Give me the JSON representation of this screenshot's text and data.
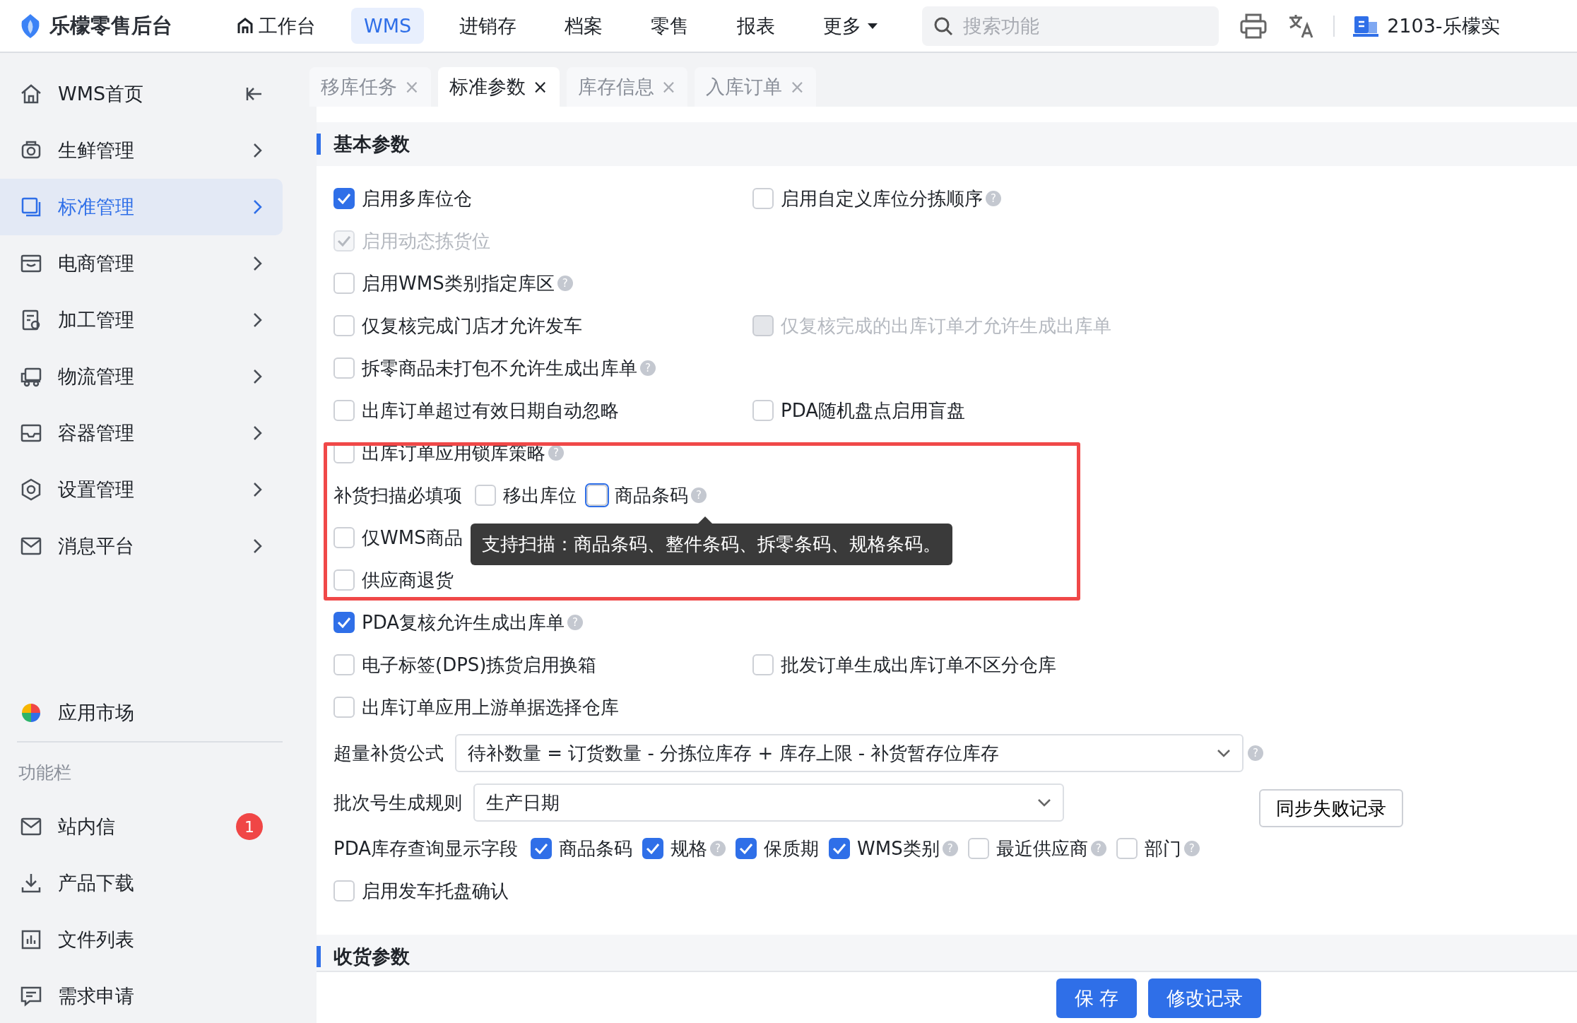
{
  "app": {
    "title": "乐檬零售后台"
  },
  "top_nav": [
    {
      "label": "工作台",
      "selected": false,
      "home": true
    },
    {
      "label": "WMS",
      "selected": true
    },
    {
      "label": "进销存",
      "selected": false
    },
    {
      "label": "档案",
      "selected": false
    },
    {
      "label": "零售",
      "selected": false
    },
    {
      "label": "报表",
      "selected": false
    },
    {
      "label": "更多",
      "selected": false,
      "dropdown": true
    }
  ],
  "search": {
    "placeholder": "搜索功能"
  },
  "store": {
    "name": "2103-乐檬实"
  },
  "sidebar": {
    "items": [
      {
        "label": "WMS首页",
        "selected": false,
        "collapse": true
      },
      {
        "label": "生鲜管理",
        "selected": false
      },
      {
        "label": "标准管理",
        "selected": true
      },
      {
        "label": "电商管理",
        "selected": false
      },
      {
        "label": "加工管理",
        "selected": false
      },
      {
        "label": "物流管理",
        "selected": false
      },
      {
        "label": "容器管理",
        "selected": false
      },
      {
        "label": "设置管理",
        "selected": false
      },
      {
        "label": "消息平台",
        "selected": false
      }
    ],
    "market": {
      "label": "应用市场"
    },
    "section_title": "功能栏",
    "tools": [
      {
        "label": "站内信",
        "badge": "1"
      },
      {
        "label": "产品下载"
      },
      {
        "label": "文件列表"
      },
      {
        "label": "需求申请"
      }
    ]
  },
  "tabs": [
    {
      "label": "移库任务",
      "selected": false,
      "close": "×"
    },
    {
      "label": "标准参数",
      "selected": true,
      "close": "×"
    },
    {
      "label": "库存信息",
      "selected": false,
      "close": "×"
    },
    {
      "label": "入库订单",
      "selected": false,
      "close": "×"
    }
  ],
  "sections": [
    {
      "title": "基本参数",
      "rows": [
        {
          "kind": "checks",
          "items": [
            {
              "label": "启用多库位仓",
              "checked": true,
              "disabled": false
            },
            {
              "label": "启用自定义库位分拣顺序",
              "checked": false,
              "disabled": false,
              "help": "?"
            }
          ]
        },
        {
          "kind": "checks",
          "items": [
            {
              "label": "启用动态拣货位",
              "checked": true,
              "disabled": true
            }
          ]
        },
        {
          "kind": "checks",
          "items": [
            {
              "label": "启用WMS类别指定库区",
              "checked": false,
              "disabled": false,
              "help": "?"
            }
          ]
        },
        {
          "kind": "checks",
          "items": [
            {
              "label": "仅复核完成门店才允许发车",
              "checked": false,
              "disabled": false
            },
            {
              "label": "仅复核完成的出库订单才允许生成出库单",
              "checked": false,
              "disabled": true
            }
          ]
        },
        {
          "kind": "checks",
          "items": [
            {
              "label": "拆零商品未打包不允许生成出库单",
              "checked": false,
              "disabled": false,
              "help": "?"
            }
          ]
        },
        {
          "kind": "checks",
          "items": [
            {
              "label": "出库订单超过有效日期自动忽略",
              "checked": false,
              "disabled": false
            },
            {
              "label": "PDA随机盘点启用盲盘",
              "checked": false,
              "disabled": false
            }
          ]
        },
        {
          "kind": "checks",
          "items": [
            {
              "label": "出库订单应用锁库策略",
              "checked": false,
              "disabled": false,
              "help": "?"
            }
          ]
        },
        {
          "kind": "group",
          "label": "补货扫描必填项",
          "highlighted": true,
          "items": [
            {
              "label": "移出库位",
              "checked": false
            },
            {
              "label": "商品条码",
              "checked": false,
              "focused": true,
              "help": "?",
              "tooltip": "支持扫描：商品条码、整件条码、拆零条码、规格条码。"
            }
          ]
        },
        {
          "kind": "checks",
          "items": [
            {
              "label": "仅WMS商品",
              "checked": false,
              "disabled": false
            }
          ]
        },
        {
          "kind": "checks",
          "items": [
            {
              "label": "供应商退货",
              "checked": false,
              "disabled": false
            }
          ]
        },
        {
          "kind": "checks",
          "items": [
            {
              "label": "PDA复核允许生成出库单",
              "checked": true,
              "disabled": false,
              "help": "?"
            }
          ]
        },
        {
          "kind": "checks",
          "items": [
            {
              "label": "电子标签(DPS)拣货启用换箱",
              "checked": false,
              "disabled": false
            },
            {
              "label": "批发订单生成出库订单不区分仓库",
              "checked": false,
              "disabled": false
            }
          ]
        },
        {
          "kind": "checks",
          "items": [
            {
              "label": "出库订单应用上游单据选择仓库",
              "checked": false,
              "disabled": false
            }
          ]
        },
        {
          "kind": "select",
          "label": "超量补货公式",
          "value": "待补数量 = 订货数量 - 分拣位库存 + 库存上限 - 补货暂存位库存",
          "help": "?"
        },
        {
          "kind": "select",
          "label": "批次号生成规则",
          "value": "生产日期",
          "button": "同步失败记录"
        },
        {
          "kind": "group",
          "label": "PDA库存查询显示字段",
          "items": [
            {
              "label": "商品条码",
              "checked": true
            },
            {
              "label": "规格",
              "checked": true,
              "help": "?"
            },
            {
              "label": "保质期",
              "checked": true
            },
            {
              "label": "WMS类别",
              "checked": true,
              "help": "?"
            },
            {
              "label": "最近供应商",
              "checked": false,
              "help": "?"
            },
            {
              "label": "部门",
              "checked": false,
              "help": "?"
            }
          ]
        },
        {
          "kind": "checks",
          "items": [
            {
              "label": "启用发车托盘确认",
              "checked": false,
              "disabled": false
            }
          ]
        }
      ]
    },
    {
      "title": "收货参数"
    }
  ],
  "footer": {
    "buttons": [
      {
        "label": "保 存"
      },
      {
        "label": "修改记录"
      }
    ]
  }
}
